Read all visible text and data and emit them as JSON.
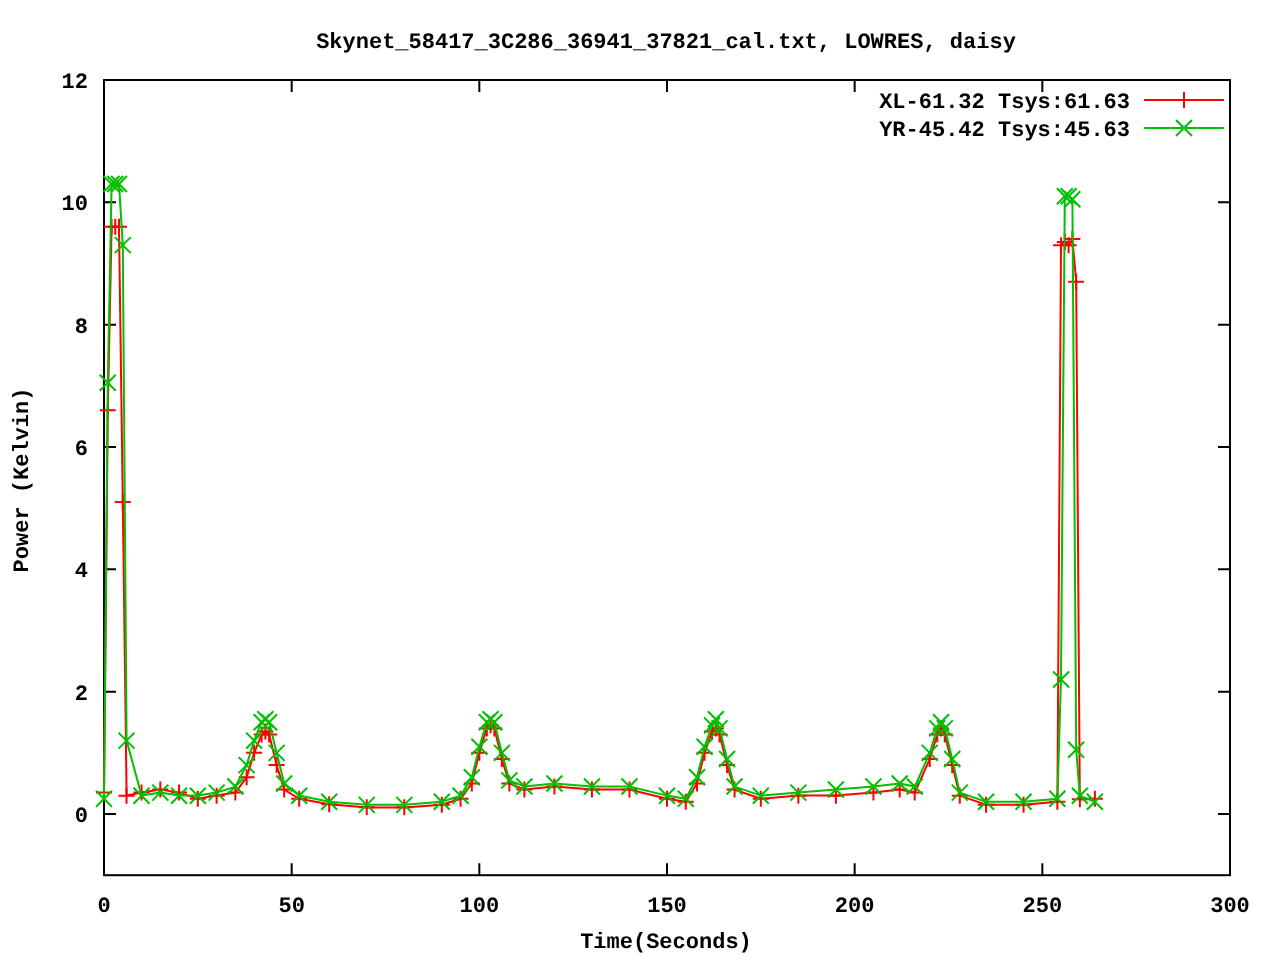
{
  "chart_data": {
    "type": "line",
    "title": "Skynet_58417_3C286_36941_37821_cal.txt, LOWRES, daisy",
    "xlabel": "Time(Seconds)",
    "ylabel": "Power (Kelvin)",
    "x": [
      0,
      1,
      2,
      3,
      4,
      5,
      6,
      10,
      15,
      20,
      25,
      30,
      35,
      38,
      40,
      42,
      43,
      44,
      46,
      48,
      52,
      60,
      70,
      80,
      90,
      95,
      98,
      100,
      102,
      103,
      104,
      106,
      108,
      112,
      120,
      130,
      140,
      150,
      155,
      158,
      160,
      162,
      163,
      164,
      166,
      168,
      175,
      185,
      195,
      205,
      212,
      216,
      220,
      222,
      223,
      224,
      226,
      228,
      235,
      245,
      254,
      255,
      256,
      257,
      258,
      259,
      260,
      264
    ],
    "series": [
      {
        "name": "XL-61.32 Tsys:61.63",
        "color": "#ff0000",
        "marker": "plus",
        "values": [
          0.35,
          6.6,
          9.6,
          9.6,
          9.6,
          5.1,
          0.3,
          0.35,
          0.4,
          0.35,
          0.25,
          0.3,
          0.35,
          0.6,
          1.0,
          1.3,
          1.35,
          1.3,
          0.8,
          0.4,
          0.25,
          0.16,
          0.11,
          0.11,
          0.15,
          0.25,
          0.5,
          1.0,
          1.4,
          1.45,
          1.4,
          0.9,
          0.5,
          0.4,
          0.45,
          0.4,
          0.4,
          0.25,
          0.2,
          0.5,
          1.0,
          1.35,
          1.4,
          1.3,
          0.8,
          0.4,
          0.25,
          0.3,
          0.3,
          0.35,
          0.4,
          0.35,
          0.9,
          1.3,
          1.4,
          1.3,
          0.8,
          0.3,
          0.15,
          0.15,
          0.2,
          9.3,
          9.35,
          9.3,
          9.4,
          8.7,
          0.24,
          0.25
        ]
      },
      {
        "name": "YR-45.42 Tsys:45.63",
        "color": "#00c000",
        "marker": "cross",
        "values": [
          0.25,
          7.05,
          10.3,
          10.3,
          10.3,
          9.3,
          1.2,
          0.3,
          0.35,
          0.3,
          0.3,
          0.35,
          0.45,
          0.8,
          1.2,
          1.5,
          1.55,
          1.5,
          1.0,
          0.5,
          0.3,
          0.2,
          0.15,
          0.15,
          0.2,
          0.3,
          0.6,
          1.1,
          1.5,
          1.55,
          1.5,
          1.0,
          0.55,
          0.45,
          0.5,
          0.45,
          0.45,
          0.3,
          0.25,
          0.6,
          1.1,
          1.45,
          1.55,
          1.4,
          0.9,
          0.45,
          0.3,
          0.35,
          0.4,
          0.45,
          0.5,
          0.45,
          1.0,
          1.4,
          1.5,
          1.4,
          0.9,
          0.35,
          0.2,
          0.2,
          0.25,
          2.2,
          10.1,
          10.1,
          10.05,
          1.05,
          0.3,
          0.2
        ]
      }
    ],
    "legend": "top right",
    "xlim": [
      0,
      300
    ],
    "ylim": [
      -1,
      12
    ],
    "xticks": [
      0,
      50,
      100,
      150,
      200,
      250,
      300
    ],
    "yticks": [
      0,
      2,
      4,
      6,
      8,
      10,
      12
    ]
  }
}
